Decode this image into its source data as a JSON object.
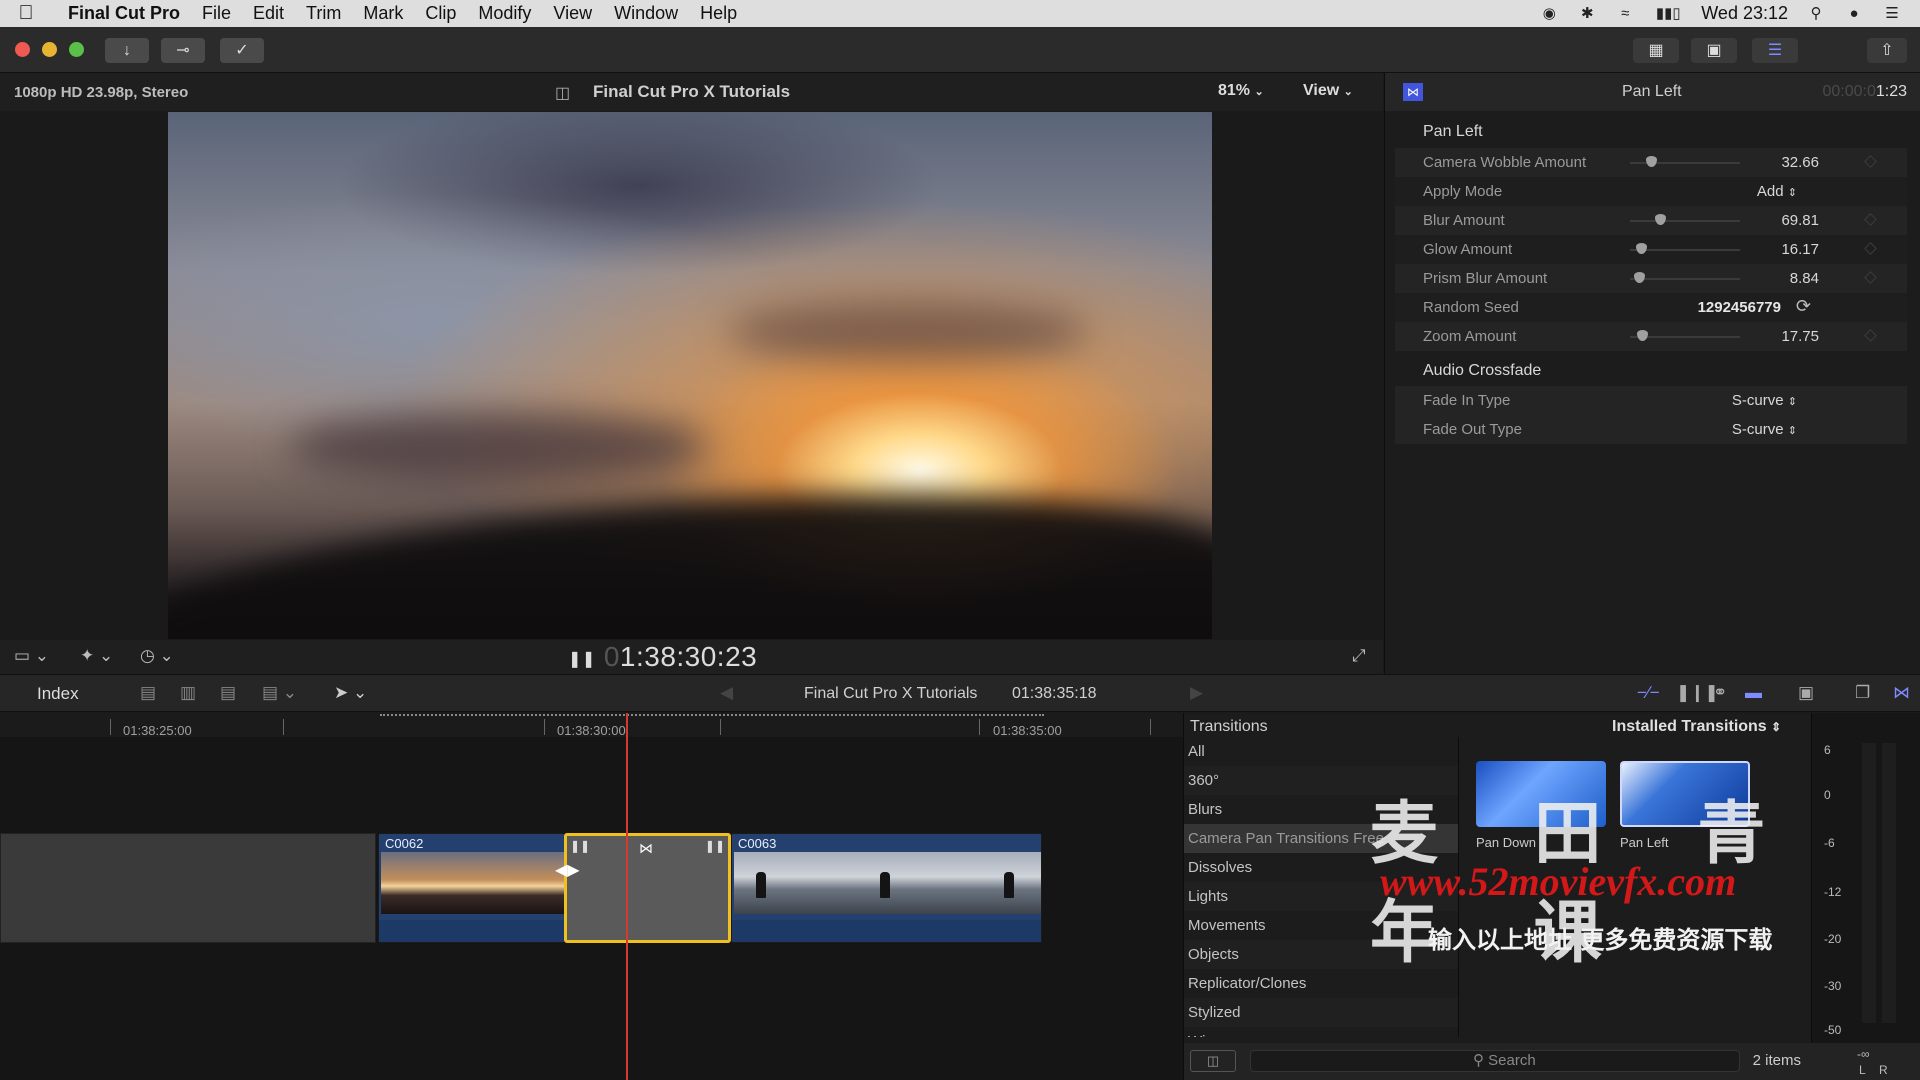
{
  "menubar": {
    "app_name": "Final Cut Pro",
    "items": [
      "File",
      "Edit",
      "Trim",
      "Mark",
      "Clip",
      "Modify",
      "View",
      "Window",
      "Help"
    ],
    "clock": "Wed 23:12"
  },
  "viewer": {
    "format": "1080p HD 23.98p, Stereo",
    "project_title": "Final Cut Pro X Tutorials",
    "zoom": "81%",
    "view_label": "View",
    "timecode_dim": "0",
    "timecode": "1:38:30:23"
  },
  "inspector": {
    "title": "Pan Left",
    "duration_dim": "00:00:0",
    "duration": "1:23",
    "section_effect": "Pan Left",
    "params": [
      {
        "label": "Camera Wobble Amount",
        "value": "32.66",
        "level": 0.16
      },
      {
        "label": "Apply Mode",
        "value": "Add"
      },
      {
        "label": "Blur Amount",
        "value": "69.81",
        "level": 0.26
      },
      {
        "label": "Glow Amount",
        "value": "16.17",
        "level": 0.04
      },
      {
        "label": "Prism Blur Amount",
        "value": "8.84",
        "level": 0.02
      },
      {
        "label": "Random Seed",
        "value": "1292456779"
      },
      {
        "label": "Zoom Amount",
        "value": "17.75",
        "level": 0.06
      }
    ],
    "section_audio": "Audio Crossfade",
    "audio": [
      {
        "label": "Fade In Type",
        "value": "S-curve"
      },
      {
        "label": "Fade Out Type",
        "value": "S-curve"
      }
    ]
  },
  "timeline_bar": {
    "index_label": "Index",
    "project": "Final Cut Pro X Tutorials",
    "duration": "01:38:35:18"
  },
  "timeline": {
    "ruler": [
      "01:38:25:00",
      "01:38:30:00",
      "01:38:35:00"
    ],
    "clips": [
      "C0062",
      "C0063"
    ]
  },
  "browser": {
    "title": "Transitions",
    "installed_label": "Installed Transitions",
    "categories": [
      "All",
      "360°",
      "Blurs",
      "Camera Pan Transitions Free",
      "Dissolves",
      "Lights",
      "Movements",
      "Objects",
      "Replicator/Clones",
      "Stylized",
      "Wipes"
    ],
    "items": [
      "Pan Down",
      "Pan Left"
    ],
    "meter_scale": [
      "6",
      "0",
      "-6",
      "-12",
      "-20",
      "-30",
      "-50",
      "-∞"
    ],
    "meter_channels": [
      "L",
      "R"
    ],
    "search_placeholder": "Search",
    "count": "2 items"
  },
  "watermark": {
    "cn_title": "麦 田 青 年 课",
    "url": "www.52movievfx.com",
    "cn_sub": "输入以上地址 更多免费资源下载"
  },
  "colors": {
    "accent": "#7e8cff",
    "playhead": "#d23c2e",
    "transition_border": "#f0c020",
    "clip_blue": "#24406e"
  }
}
